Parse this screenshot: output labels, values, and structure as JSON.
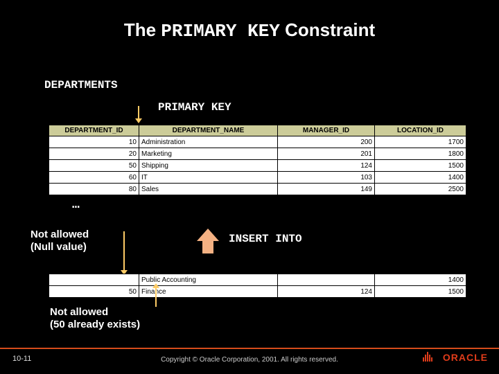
{
  "title_prefix": "The ",
  "title_mono": "PRIMARY KEY",
  "title_suffix": " Constraint",
  "subtitle": "DEPARTMENTS",
  "pk_label": "PRIMARY KEY",
  "ellipsis": "…",
  "not_allowed_null_l1": "Not allowed",
  "not_allowed_null_l2": "(Null value)",
  "insert_into": "INSERT INTO",
  "not_allowed_dup_l1": "Not allowed",
  "not_allowed_dup_l2": "(50 already exists)",
  "footer": {
    "page": "10-11",
    "copyright": "Copyright © Oracle Corporation, 2001. All rights reserved.",
    "logo_text": "ORACLE"
  },
  "columns": {
    "c0": "DEPARTMENT_ID",
    "c1": "DEPARTMENT_NAME",
    "c2": "MANAGER_ID",
    "c3": "LOCATION_ID"
  },
  "rows1": [
    {
      "id": "10",
      "name": "Administration",
      "mgr": "200",
      "loc": "1700"
    },
    {
      "id": "20",
      "name": "Marketing",
      "mgr": "201",
      "loc": "1800"
    },
    {
      "id": "50",
      "name": "Shipping",
      "mgr": "124",
      "loc": "1500"
    },
    {
      "id": "60",
      "name": "IT",
      "mgr": "103",
      "loc": "1400"
    },
    {
      "id": "80",
      "name": "Sales",
      "mgr": "149",
      "loc": "2500"
    }
  ],
  "rows2": [
    {
      "id": "",
      "name": "Public Accounting",
      "mgr": "",
      "loc": "1400"
    },
    {
      "id": "50",
      "name": "Finance",
      "mgr": "124",
      "loc": "1500"
    }
  ]
}
